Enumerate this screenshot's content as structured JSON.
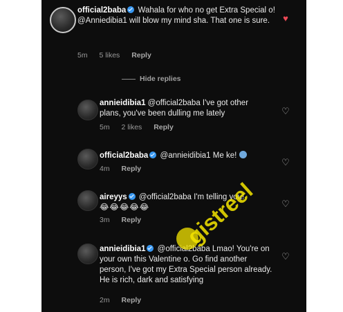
{
  "comments": [
    {
      "user": "official2baba",
      "text": "Wahala for who no get Extra Special o! @Anniedibia1 will blow my mind sha. That one is sure.",
      "time": "5m",
      "likes": "5 likes",
      "reply": "Reply",
      "liked": true
    },
    {
      "user": "annieidibia1",
      "text": "@official2baba I've got other plans, you've been dulling me lately",
      "time": "5m",
      "likes": "2 likes",
      "reply": "Reply",
      "liked": false
    },
    {
      "user": "official2baba",
      "text": "@annieidibia1 Me ke!",
      "time": "4m",
      "reply": "Reply",
      "liked": false
    },
    {
      "user": "aireyys",
      "text": "@official2baba I'm telling you!",
      "emojis": "😂😂😂😂😂",
      "time": "3m",
      "reply": "Reply",
      "liked": false
    },
    {
      "user": "annieidibia1",
      "text": "@official2baba Lmao! You're on your own this Valentine o. Go find another person, I've got my Extra Special person already. He is rich, dark and satisfying",
      "time": "2m",
      "reply": "Reply",
      "liked": false
    }
  ],
  "hide_replies": "Hide replies",
  "watermark": "gistreel",
  "colors": {
    "background": "#0d0d0d",
    "liked_heart": "#ed4956",
    "verified": "#3897f0",
    "watermark": "#f5e600"
  }
}
